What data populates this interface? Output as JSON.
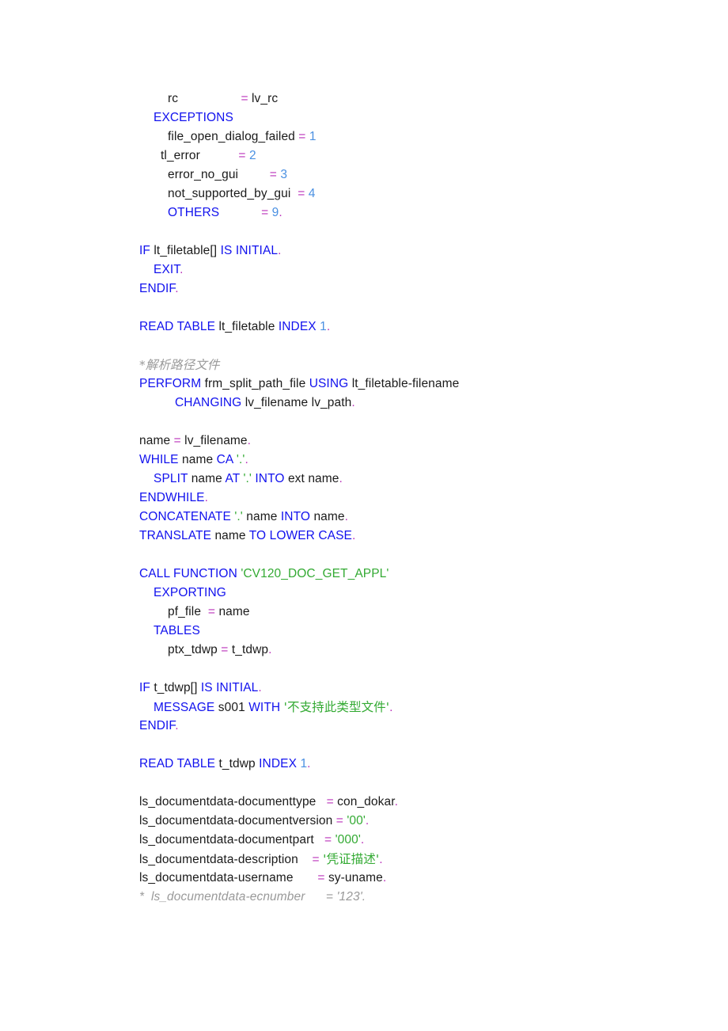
{
  "document": {
    "kind": "source-code-listing",
    "language": "ABAP",
    "background_color": "#ffffff"
  },
  "palette": {
    "keyword": "#1111ee",
    "identifier": "#1a1a1a",
    "operator": "#bb33bb",
    "number": "#4a90e2",
    "string": "#33aa33",
    "punctuation": "#bb33bb",
    "comment": "#9a9a9a"
  },
  "code": {
    "lines": [
      {
        "id": 1,
        "indent": 4,
        "text": "rc                  = lv_rc",
        "tokens": [
          {
            "t": "rc                  ",
            "c": "plain"
          },
          {
            "t": "=",
            "c": "eq"
          },
          {
            "t": " lv_rc",
            "c": "plain"
          }
        ]
      },
      {
        "id": 2,
        "indent": 2,
        "text": "EXCEPTIONS",
        "tokens": [
          {
            "t": "EXCEPTIONS",
            "c": "kw"
          }
        ]
      },
      {
        "id": 3,
        "indent": 4,
        "text": "file_open_dialog_failed = 1",
        "tokens": [
          {
            "t": "file_open_dialog_failed ",
            "c": "plain"
          },
          {
            "t": "=",
            "c": "eq"
          },
          {
            "t": " ",
            "c": "plain"
          },
          {
            "t": "1",
            "c": "num"
          }
        ]
      },
      {
        "id": 4,
        "indent": 3,
        "text": "tl_error            = 2",
        "tokens": [
          {
            "t": "tl_error           ",
            "c": "plain"
          },
          {
            "t": "=",
            "c": "eq"
          },
          {
            "t": " ",
            "c": "plain"
          },
          {
            "t": "2",
            "c": "num"
          }
        ]
      },
      {
        "id": 5,
        "indent": 4,
        "text": "error_no_gui          = 3",
        "tokens": [
          {
            "t": "error_no_gui         ",
            "c": "plain"
          },
          {
            "t": "=",
            "c": "eq"
          },
          {
            "t": " ",
            "c": "plain"
          },
          {
            "t": "3",
            "c": "num"
          }
        ]
      },
      {
        "id": 6,
        "indent": 4,
        "text": "not_supported_by_gui   = 4",
        "tokens": [
          {
            "t": "not_supported_by_gui  ",
            "c": "plain"
          },
          {
            "t": "=",
            "c": "eq"
          },
          {
            "t": " ",
            "c": "plain"
          },
          {
            "t": "4",
            "c": "num"
          }
        ]
      },
      {
        "id": 7,
        "indent": 4,
        "text": "OTHERS             = 9.",
        "tokens": [
          {
            "t": "OTHERS",
            "c": "kw"
          },
          {
            "t": "            ",
            "c": "plain"
          },
          {
            "t": "=",
            "c": "eq"
          },
          {
            "t": " ",
            "c": "plain"
          },
          {
            "t": "9",
            "c": "num"
          },
          {
            "t": ".",
            "c": "punc"
          }
        ]
      },
      {
        "id": 8,
        "indent": 0,
        "text": "",
        "tokens": []
      },
      {
        "id": 9,
        "indent": 0,
        "text": "IF lt_filetable[] IS INITIAL.",
        "tokens": [
          {
            "t": "IF",
            "c": "kw"
          },
          {
            "t": " lt_filetable[] ",
            "c": "plain"
          },
          {
            "t": "IS INITIAL",
            "c": "kw"
          },
          {
            "t": ".",
            "c": "punc"
          }
        ]
      },
      {
        "id": 10,
        "indent": 2,
        "text": "EXIT.",
        "tokens": [
          {
            "t": "EXIT",
            "c": "kw"
          },
          {
            "t": ".",
            "c": "punc"
          }
        ]
      },
      {
        "id": 11,
        "indent": 0,
        "text": "ENDIF.",
        "tokens": [
          {
            "t": "ENDIF",
            "c": "kw"
          },
          {
            "t": ".",
            "c": "punc"
          }
        ]
      },
      {
        "id": 12,
        "indent": 0,
        "text": "",
        "tokens": []
      },
      {
        "id": 13,
        "indent": 0,
        "text": "READ TABLE lt_filetable INDEX 1.",
        "tokens": [
          {
            "t": "READ TABLE",
            "c": "kw"
          },
          {
            "t": " lt_filetable ",
            "c": "plain"
          },
          {
            "t": "INDEX",
            "c": "kw"
          },
          {
            "t": " ",
            "c": "plain"
          },
          {
            "t": "1",
            "c": "num"
          },
          {
            "t": ".",
            "c": "punc"
          }
        ]
      },
      {
        "id": 14,
        "indent": 0,
        "text": "",
        "tokens": []
      },
      {
        "id": 15,
        "indent": -1,
        "text": "*解析路径文件",
        "tokens": [
          {
            "t": "*解析路径文件",
            "c": "cmt"
          }
        ]
      },
      {
        "id": 16,
        "indent": 0,
        "text": "PERFORM frm_split_path_file USING lt_filetable-filename",
        "tokens": [
          {
            "t": "PERFORM",
            "c": "kw"
          },
          {
            "t": " frm_split_path_file ",
            "c": "plain"
          },
          {
            "t": "USING",
            "c": "kw"
          },
          {
            "t": " lt_filetable-filename",
            "c": "plain"
          }
        ]
      },
      {
        "id": 17,
        "indent": 5,
        "text": "CHANGING lv_filename lv_path.",
        "tokens": [
          {
            "t": "CHANGING",
            "c": "kw"
          },
          {
            "t": " lv_filename lv_path",
            "c": "plain"
          },
          {
            "t": ".",
            "c": "punc"
          }
        ]
      },
      {
        "id": 18,
        "indent": 0,
        "text": "",
        "tokens": []
      },
      {
        "id": 19,
        "indent": 0,
        "text": "name = lv_filename.",
        "tokens": [
          {
            "t": "name ",
            "c": "plain"
          },
          {
            "t": "=",
            "c": "eq"
          },
          {
            "t": " lv_filename",
            "c": "plain"
          },
          {
            "t": ".",
            "c": "punc"
          }
        ]
      },
      {
        "id": 20,
        "indent": 0,
        "text": "WHILE name CA '.'.",
        "tokens": [
          {
            "t": "WHILE",
            "c": "kw"
          },
          {
            "t": " name ",
            "c": "plain"
          },
          {
            "t": "CA",
            "c": "kw"
          },
          {
            "t": " ",
            "c": "plain"
          },
          {
            "t": "'.'",
            "c": "str"
          },
          {
            "t": ".",
            "c": "punc"
          }
        ]
      },
      {
        "id": 21,
        "indent": 2,
        "text": "SPLIT name AT '.' INTO ext name.",
        "tokens": [
          {
            "t": "SPLIT",
            "c": "kw"
          },
          {
            "t": " name ",
            "c": "plain"
          },
          {
            "t": "AT",
            "c": "kw"
          },
          {
            "t": " ",
            "c": "plain"
          },
          {
            "t": "'.'",
            "c": "str"
          },
          {
            "t": " ",
            "c": "plain"
          },
          {
            "t": "INTO",
            "c": "kw"
          },
          {
            "t": " ext name",
            "c": "plain"
          },
          {
            "t": ".",
            "c": "punc"
          }
        ]
      },
      {
        "id": 22,
        "indent": 0,
        "text": "ENDWHILE.",
        "tokens": [
          {
            "t": "ENDWHILE",
            "c": "kw"
          },
          {
            "t": ".",
            "c": "punc"
          }
        ]
      },
      {
        "id": 23,
        "indent": 0,
        "text": "CONCATENATE '.' name INTO name.",
        "tokens": [
          {
            "t": "CONCATENATE",
            "c": "kw"
          },
          {
            "t": " ",
            "c": "plain"
          },
          {
            "t": "'.'",
            "c": "str"
          },
          {
            "t": " name ",
            "c": "plain"
          },
          {
            "t": "INTO",
            "c": "kw"
          },
          {
            "t": " name",
            "c": "plain"
          },
          {
            "t": ".",
            "c": "punc"
          }
        ]
      },
      {
        "id": 24,
        "indent": 0,
        "text": "TRANSLATE name TO LOWER CASE.",
        "tokens": [
          {
            "t": "TRANSLATE",
            "c": "kw"
          },
          {
            "t": " name ",
            "c": "plain"
          },
          {
            "t": "TO LOWER CASE",
            "c": "kw"
          },
          {
            "t": ".",
            "c": "punc"
          }
        ]
      },
      {
        "id": 25,
        "indent": 0,
        "text": "",
        "tokens": []
      },
      {
        "id": 26,
        "indent": 0,
        "text": "CALL FUNCTION 'CV120_DOC_GET_APPL'",
        "tokens": [
          {
            "t": "CALL FUNCTION",
            "c": "kw"
          },
          {
            "t": " ",
            "c": "plain"
          },
          {
            "t": "'CV120_DOC_GET_APPL'",
            "c": "str"
          }
        ]
      },
      {
        "id": 27,
        "indent": 2,
        "text": "EXPORTING",
        "tokens": [
          {
            "t": "EXPORTING",
            "c": "kw"
          }
        ]
      },
      {
        "id": 28,
        "indent": 4,
        "text": "pf_file  = name",
        "tokens": [
          {
            "t": "pf_file  ",
            "c": "plain"
          },
          {
            "t": "=",
            "c": "eq"
          },
          {
            "t": " name",
            "c": "plain"
          }
        ]
      },
      {
        "id": 29,
        "indent": 2,
        "text": "TABLES",
        "tokens": [
          {
            "t": "TABLES",
            "c": "kw"
          }
        ]
      },
      {
        "id": 30,
        "indent": 4,
        "text": "ptx_tdwp = t_tdwp.",
        "tokens": [
          {
            "t": "ptx_tdwp ",
            "c": "plain"
          },
          {
            "t": "=",
            "c": "eq"
          },
          {
            "t": " t_tdwp",
            "c": "plain"
          },
          {
            "t": ".",
            "c": "punc"
          }
        ]
      },
      {
        "id": 31,
        "indent": 0,
        "text": "",
        "tokens": []
      },
      {
        "id": 32,
        "indent": 0,
        "text": "IF t_tdwp[] IS INITIAL.",
        "tokens": [
          {
            "t": "IF",
            "c": "kw"
          },
          {
            "t": " t_tdwp[] ",
            "c": "plain"
          },
          {
            "t": "IS INITIAL",
            "c": "kw"
          },
          {
            "t": ".",
            "c": "punc"
          }
        ]
      },
      {
        "id": 33,
        "indent": 2,
        "text": "MESSAGE s001 WITH '不支持此类型文件'.",
        "tokens": [
          {
            "t": "MESSAGE",
            "c": "kw"
          },
          {
            "t": " s001 ",
            "c": "plain"
          },
          {
            "t": "WITH",
            "c": "kw"
          },
          {
            "t": " ",
            "c": "plain"
          },
          {
            "t": "'不支持此类型文件'",
            "c": "str"
          },
          {
            "t": ".",
            "c": "punc"
          }
        ]
      },
      {
        "id": 34,
        "indent": 0,
        "text": "ENDIF.",
        "tokens": [
          {
            "t": "ENDIF",
            "c": "kw"
          },
          {
            "t": ".",
            "c": "punc"
          }
        ]
      },
      {
        "id": 35,
        "indent": 0,
        "text": "",
        "tokens": []
      },
      {
        "id": 36,
        "indent": 0,
        "text": "READ TABLE t_tdwp INDEX 1.",
        "tokens": [
          {
            "t": "READ TABLE",
            "c": "kw"
          },
          {
            "t": " t_tdwp ",
            "c": "plain"
          },
          {
            "t": "INDEX",
            "c": "kw"
          },
          {
            "t": " ",
            "c": "plain"
          },
          {
            "t": "1",
            "c": "num"
          },
          {
            "t": ".",
            "c": "punc"
          }
        ]
      },
      {
        "id": 37,
        "indent": 0,
        "text": "",
        "tokens": []
      },
      {
        "id": 38,
        "indent": 0,
        "text": "ls_documentdata-documenttype   = con_dokar.",
        "tokens": [
          {
            "t": "ls_documentdata-documenttype   ",
            "c": "plain"
          },
          {
            "t": "=",
            "c": "eq"
          },
          {
            "t": " con_dokar",
            "c": "plain"
          },
          {
            "t": ".",
            "c": "punc"
          }
        ]
      },
      {
        "id": 39,
        "indent": 0,
        "text": "ls_documentdata-documentversion = '00'.",
        "tokens": [
          {
            "t": "ls_documentdata-documentversion ",
            "c": "plain"
          },
          {
            "t": "=",
            "c": "eq"
          },
          {
            "t": " ",
            "c": "plain"
          },
          {
            "t": "'00'",
            "c": "str"
          },
          {
            "t": ".",
            "c": "punc"
          }
        ]
      },
      {
        "id": 40,
        "indent": 0,
        "text": "ls_documentdata-documentpart   = '000'.",
        "tokens": [
          {
            "t": "ls_documentdata-documentpart   ",
            "c": "plain"
          },
          {
            "t": "=",
            "c": "eq"
          },
          {
            "t": " ",
            "c": "plain"
          },
          {
            "t": "'000'",
            "c": "str"
          },
          {
            "t": ".",
            "c": "punc"
          }
        ]
      },
      {
        "id": 41,
        "indent": 0,
        "text": "ls_documentdata-description    = '凭证描述'.",
        "tokens": [
          {
            "t": "ls_documentdata-description    ",
            "c": "plain"
          },
          {
            "t": "=",
            "c": "eq"
          },
          {
            "t": " ",
            "c": "plain"
          },
          {
            "t": "'凭证描述'",
            "c": "str"
          },
          {
            "t": ".",
            "c": "punc"
          }
        ]
      },
      {
        "id": 42,
        "indent": 0,
        "text": "ls_documentdata-username       = sy-uname.",
        "tokens": [
          {
            "t": "ls_documentdata-username       ",
            "c": "plain"
          },
          {
            "t": "=",
            "c": "eq"
          },
          {
            "t": " sy-uname",
            "c": "plain"
          },
          {
            "t": ".",
            "c": "punc"
          }
        ]
      },
      {
        "id": 43,
        "indent": -1,
        "text": "*  ls_documentdata-ecnumber      = '123'.",
        "tokens": [
          {
            "t": "*  ls_documentdata-ecnumber      = '123'.",
            "c": "cmt"
          }
        ]
      }
    ]
  }
}
